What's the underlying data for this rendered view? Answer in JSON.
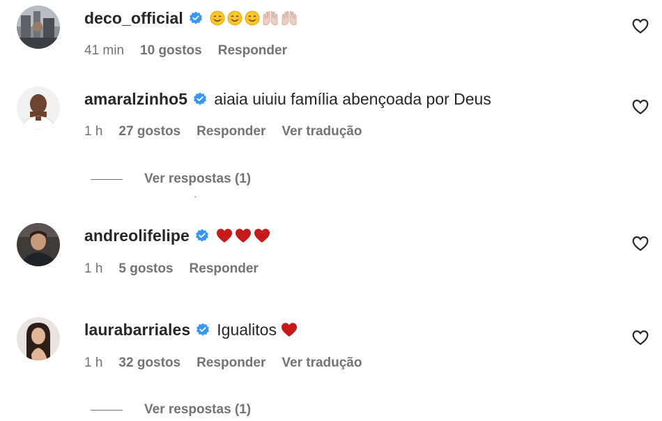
{
  "colors": {
    "text_primary": "#262626",
    "text_secondary": "#737373",
    "verified_blue": "#3897f0",
    "heart_red": "#c51a1a"
  },
  "comments": [
    {
      "username": "deco_official",
      "verified": true,
      "text": "",
      "emojis": [
        "smiling-face-icon",
        "smiling-face-icon",
        "smiling-face-icon",
        "raised-hands-icon",
        "raised-hands-icon"
      ],
      "time": "41 min",
      "likes": "10 gostos",
      "reply": "Responder",
      "translate": ""
    },
    {
      "username": "amaralzinho5",
      "verified": true,
      "text": "aiaia uiuiu família abençoada por Deus",
      "time": "1 h",
      "likes": "27 gostos",
      "reply": "Responder",
      "translate": "Ver tradução",
      "view_replies": "Ver respostas (1)"
    },
    {
      "username": "andreolifelipe",
      "verified": true,
      "text": "",
      "emojis": [
        "red-heart-icon",
        "red-heart-icon",
        "red-heart-icon"
      ],
      "time": "1 h",
      "likes": "5 gostos",
      "reply": "Responder"
    },
    {
      "username": "laurabarriales",
      "verified": true,
      "text": "Igualitos",
      "emojis": [
        "red-heart-icon"
      ],
      "time": "1 h",
      "likes": "32 gostos",
      "reply": "Responder",
      "translate": "Ver tradução",
      "view_replies": "Ver respostas (1)"
    }
  ]
}
